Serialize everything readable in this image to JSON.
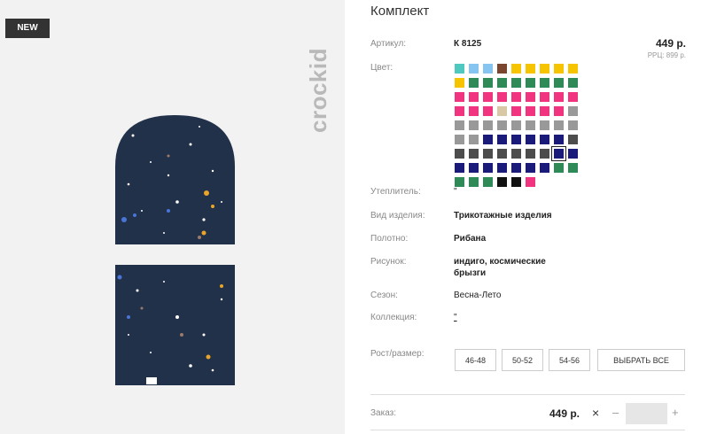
{
  "gallery": {
    "badge": "NEW",
    "brand_logo": "crockid"
  },
  "product": {
    "title": "Комплект",
    "price": "449 р.",
    "rrc": "РРЦ: 899 р.",
    "color_swatches": [
      "#4fc9c0",
      "#86c5ef",
      "#86c5ef",
      "#7a4630",
      "#f6c400",
      "#f6c400",
      "#f6c400",
      "#f6c400",
      "#f6c400",
      "#f6c400",
      "#2e8b57",
      "#2e8b57",
      "#2e8b57",
      "#2e8b57",
      "#2e8b57",
      "#2e8b57",
      "#2e8b57",
      "#2e8b57",
      "#f0347f",
      "#f0347f",
      "#f0347f",
      "#f0347f",
      "#f0347f",
      "#f0347f",
      "#f0347f",
      "#f0347f",
      "#f0347f",
      "#f0347f",
      "#f0347f",
      "#f0347f",
      "#d9c8a5",
      "#f0347f",
      "#f0347f",
      "#f0347f",
      "#f0347f",
      "#999999",
      "#999999",
      "#999999",
      "#999999",
      "#999999",
      "#999999",
      "#999999",
      "#999999",
      "#999999",
      "#999999",
      "#999999",
      "#999999",
      "#1a1a7a",
      "#1a1a7a",
      "#1a1a7a",
      "#1a1a7a",
      "#1a1a7a",
      "#1a1a7a",
      "#4d4d4d",
      "#4d4d4d",
      "#4d4d4d",
      "#4d4d4d",
      "#4d4d4d",
      "#4d4d4d",
      "#4d4d4d",
      "#4d4d4d",
      "#1a1a7a",
      "#1a1a7a",
      "#1a1a7a",
      "#1a1a7a",
      "#1a1a7a",
      "#1a1a7a",
      "#1a1a7a",
      "#1a1a7a",
      "#1a1a7a",
      "#2e8b57",
      "#2e8b57",
      "#2e8b57",
      "#2e8b57",
      "#2e8b57",
      "#111111",
      "#111111",
      "#f0347f"
    ],
    "selected_swatch_index": 61
  },
  "specs": {
    "article_label": "Артикул:",
    "article_value": "К 8125",
    "color_label": "Цвет:",
    "insulation_label": "Утеплитель:",
    "insulation_value": "\"",
    "type_label": "Вид изделия:",
    "type_value": "Трикотажные изделия",
    "fabric_label": "Полотно:",
    "fabric_value": "Рибана",
    "pattern_label": "Рисунок:",
    "pattern_value_line1": "индиго, космические",
    "pattern_value_line2": "брызги",
    "season_label": "Сезон:",
    "season_value": "Весна-Лето",
    "collection_label": "Коллекция:",
    "collection_value": "\""
  },
  "sizes": {
    "label": "Рост/размер:",
    "options": [
      "46-48",
      "50-52",
      "54-56"
    ],
    "select_all": "ВЫБРАТЬ ВСЕ"
  },
  "order": {
    "label": "Заказ:",
    "price": "449 р.",
    "times": "×",
    "minus": "–",
    "plus": "+",
    "quantity": ""
  }
}
